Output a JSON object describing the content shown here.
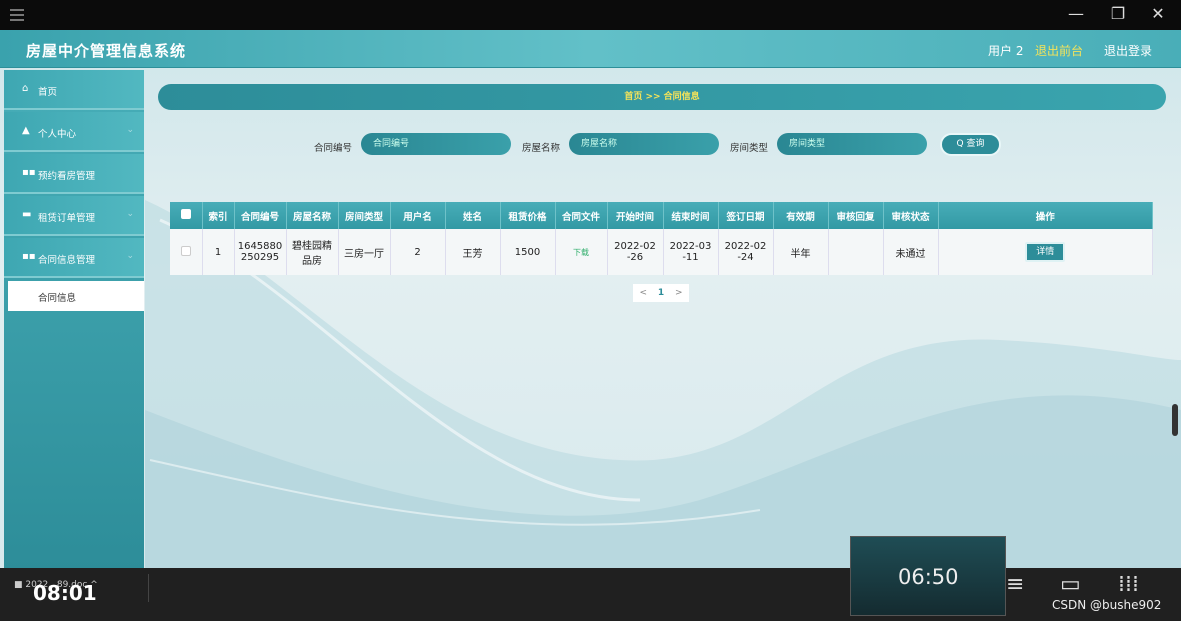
{
  "window": {
    "min": "—",
    "restore": "❐",
    "close": "✕"
  },
  "header": {
    "title": "房屋中介管理信息系统",
    "user": "用户 2",
    "backend": "退出前台",
    "logout": "退出登录"
  },
  "sidebar": {
    "items": [
      {
        "label": "首页",
        "icon": "home-icon",
        "glyph": "⌂"
      },
      {
        "label": "个人中心",
        "icon": "user-icon",
        "glyph": "▲"
      },
      {
        "label": "预约看房管理",
        "icon": "grid-icon",
        "glyph": "▪▪"
      },
      {
        "label": "租赁订单管理",
        "icon": "ticket-icon",
        "glyph": "▬"
      },
      {
        "label": "合同信息管理",
        "icon": "grid-icon",
        "glyph": "▪▪"
      }
    ],
    "sub": "合同信息",
    "chev": "⌄"
  },
  "breadcrumb": "首页 >> 合同信息",
  "search": {
    "fields": [
      {
        "label": "合同编号",
        "placeholder": "合同编号"
      },
      {
        "label": "房屋名称",
        "placeholder": "房屋名称"
      },
      {
        "label": "房间类型",
        "placeholder": "房间类型"
      }
    ],
    "button": "Q 查询"
  },
  "table": {
    "columns": [
      "索引",
      "合同编号",
      "房屋名称",
      "房间类型",
      "用户名",
      "姓名",
      "租赁价格",
      "合同文件",
      "开始时间",
      "结束时间",
      "签订日期",
      "有效期",
      "审核回复",
      "审核状态",
      "操作"
    ],
    "rows": [
      {
        "index": "1",
        "contract_no_1": "1645880",
        "contract_no_2": "250295",
        "house_1": "碧桂园精",
        "house_2": "品房",
        "room_type": "三房一厅",
        "username": "2",
        "name": "王芳",
        "price": "1500",
        "file": "下载",
        "start_1": "2022-02",
        "start_2": "-26",
        "end_1": "2022-03",
        "end_2": "-11",
        "sign_1": "2022-02",
        "sign_2": "-24",
        "validity": "半年",
        "reply": "",
        "status": "未通过",
        "action": "详情"
      }
    ]
  },
  "pager": {
    "prev": "<",
    "current": "1",
    "next": ">"
  },
  "taskbar": {
    "file": "■ 2022...89.doc  ^",
    "time_left": "08:01",
    "time_right": "06:50",
    "watermark": "CSDN @bushe902"
  }
}
